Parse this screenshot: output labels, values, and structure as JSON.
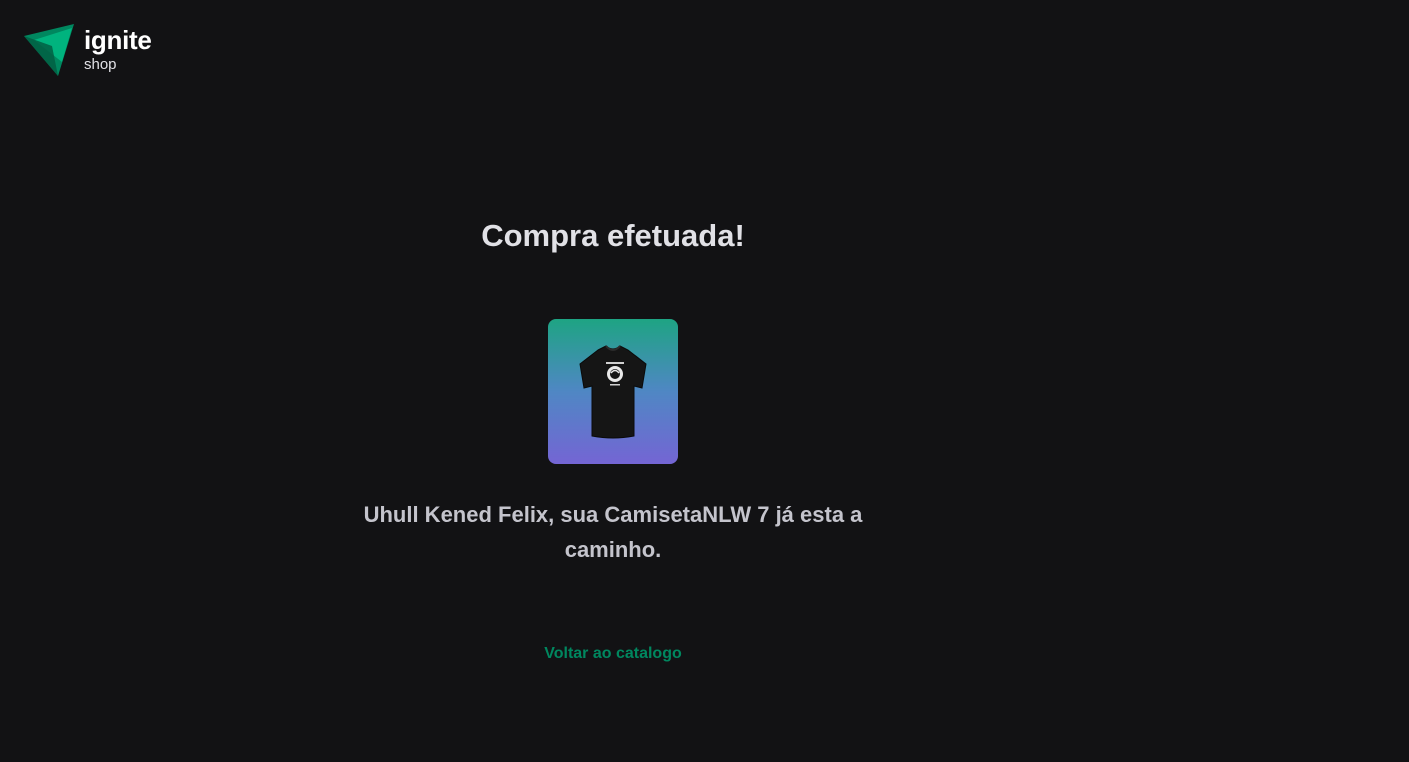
{
  "header": {
    "logo_icon": "ignite-logo-icon",
    "logo_title": "ignite",
    "logo_subtitle": "shop"
  },
  "success": {
    "title": "Compra efetuada!",
    "product_image_icon": "black-tshirt-image",
    "message": "Uhull Kened Felix, sua CamisetaNLW 7 já esta a caminho.",
    "back_link": "Voltar ao catalogo"
  },
  "colors": {
    "background": "#121214",
    "brand_green": "#00875f",
    "brand_green_light": "#00b37e",
    "text_title": "#e1e1e6",
    "text_body": "#c4c4cc",
    "gradient_top": "#1ea483",
    "gradient_bottom": "#7465d4"
  }
}
